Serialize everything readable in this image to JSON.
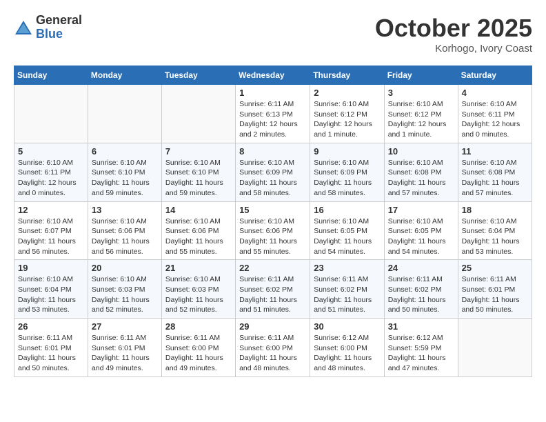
{
  "logo": {
    "general": "General",
    "blue": "Blue"
  },
  "header": {
    "month": "October 2025",
    "location": "Korhogo, Ivory Coast"
  },
  "weekdays": [
    "Sunday",
    "Monday",
    "Tuesday",
    "Wednesday",
    "Thursday",
    "Friday",
    "Saturday"
  ],
  "weeks": [
    [
      {
        "day": "",
        "info": ""
      },
      {
        "day": "",
        "info": ""
      },
      {
        "day": "",
        "info": ""
      },
      {
        "day": "1",
        "info": "Sunrise: 6:11 AM\nSunset: 6:13 PM\nDaylight: 12 hours and 2 minutes."
      },
      {
        "day": "2",
        "info": "Sunrise: 6:10 AM\nSunset: 6:12 PM\nDaylight: 12 hours and 1 minute."
      },
      {
        "day": "3",
        "info": "Sunrise: 6:10 AM\nSunset: 6:12 PM\nDaylight: 12 hours and 1 minute."
      },
      {
        "day": "4",
        "info": "Sunrise: 6:10 AM\nSunset: 6:11 PM\nDaylight: 12 hours and 0 minutes."
      }
    ],
    [
      {
        "day": "5",
        "info": "Sunrise: 6:10 AM\nSunset: 6:11 PM\nDaylight: 12 hours and 0 minutes."
      },
      {
        "day": "6",
        "info": "Sunrise: 6:10 AM\nSunset: 6:10 PM\nDaylight: 11 hours and 59 minutes."
      },
      {
        "day": "7",
        "info": "Sunrise: 6:10 AM\nSunset: 6:10 PM\nDaylight: 11 hours and 59 minutes."
      },
      {
        "day": "8",
        "info": "Sunrise: 6:10 AM\nSunset: 6:09 PM\nDaylight: 11 hours and 58 minutes."
      },
      {
        "day": "9",
        "info": "Sunrise: 6:10 AM\nSunset: 6:09 PM\nDaylight: 11 hours and 58 minutes."
      },
      {
        "day": "10",
        "info": "Sunrise: 6:10 AM\nSunset: 6:08 PM\nDaylight: 11 hours and 57 minutes."
      },
      {
        "day": "11",
        "info": "Sunrise: 6:10 AM\nSunset: 6:08 PM\nDaylight: 11 hours and 57 minutes."
      }
    ],
    [
      {
        "day": "12",
        "info": "Sunrise: 6:10 AM\nSunset: 6:07 PM\nDaylight: 11 hours and 56 minutes."
      },
      {
        "day": "13",
        "info": "Sunrise: 6:10 AM\nSunset: 6:06 PM\nDaylight: 11 hours and 56 minutes."
      },
      {
        "day": "14",
        "info": "Sunrise: 6:10 AM\nSunset: 6:06 PM\nDaylight: 11 hours and 55 minutes."
      },
      {
        "day": "15",
        "info": "Sunrise: 6:10 AM\nSunset: 6:06 PM\nDaylight: 11 hours and 55 minutes."
      },
      {
        "day": "16",
        "info": "Sunrise: 6:10 AM\nSunset: 6:05 PM\nDaylight: 11 hours and 54 minutes."
      },
      {
        "day": "17",
        "info": "Sunrise: 6:10 AM\nSunset: 6:05 PM\nDaylight: 11 hours and 54 minutes."
      },
      {
        "day": "18",
        "info": "Sunrise: 6:10 AM\nSunset: 6:04 PM\nDaylight: 11 hours and 53 minutes."
      }
    ],
    [
      {
        "day": "19",
        "info": "Sunrise: 6:10 AM\nSunset: 6:04 PM\nDaylight: 11 hours and 53 minutes."
      },
      {
        "day": "20",
        "info": "Sunrise: 6:10 AM\nSunset: 6:03 PM\nDaylight: 11 hours and 52 minutes."
      },
      {
        "day": "21",
        "info": "Sunrise: 6:10 AM\nSunset: 6:03 PM\nDaylight: 11 hours and 52 minutes."
      },
      {
        "day": "22",
        "info": "Sunrise: 6:11 AM\nSunset: 6:02 PM\nDaylight: 11 hours and 51 minutes."
      },
      {
        "day": "23",
        "info": "Sunrise: 6:11 AM\nSunset: 6:02 PM\nDaylight: 11 hours and 51 minutes."
      },
      {
        "day": "24",
        "info": "Sunrise: 6:11 AM\nSunset: 6:02 PM\nDaylight: 11 hours and 50 minutes."
      },
      {
        "day": "25",
        "info": "Sunrise: 6:11 AM\nSunset: 6:01 PM\nDaylight: 11 hours and 50 minutes."
      }
    ],
    [
      {
        "day": "26",
        "info": "Sunrise: 6:11 AM\nSunset: 6:01 PM\nDaylight: 11 hours and 50 minutes."
      },
      {
        "day": "27",
        "info": "Sunrise: 6:11 AM\nSunset: 6:01 PM\nDaylight: 11 hours and 49 minutes."
      },
      {
        "day": "28",
        "info": "Sunrise: 6:11 AM\nSunset: 6:00 PM\nDaylight: 11 hours and 49 minutes."
      },
      {
        "day": "29",
        "info": "Sunrise: 6:11 AM\nSunset: 6:00 PM\nDaylight: 11 hours and 48 minutes."
      },
      {
        "day": "30",
        "info": "Sunrise: 6:12 AM\nSunset: 6:00 PM\nDaylight: 11 hours and 48 minutes."
      },
      {
        "day": "31",
        "info": "Sunrise: 6:12 AM\nSunset: 5:59 PM\nDaylight: 11 hours and 47 minutes."
      },
      {
        "day": "",
        "info": ""
      }
    ]
  ]
}
